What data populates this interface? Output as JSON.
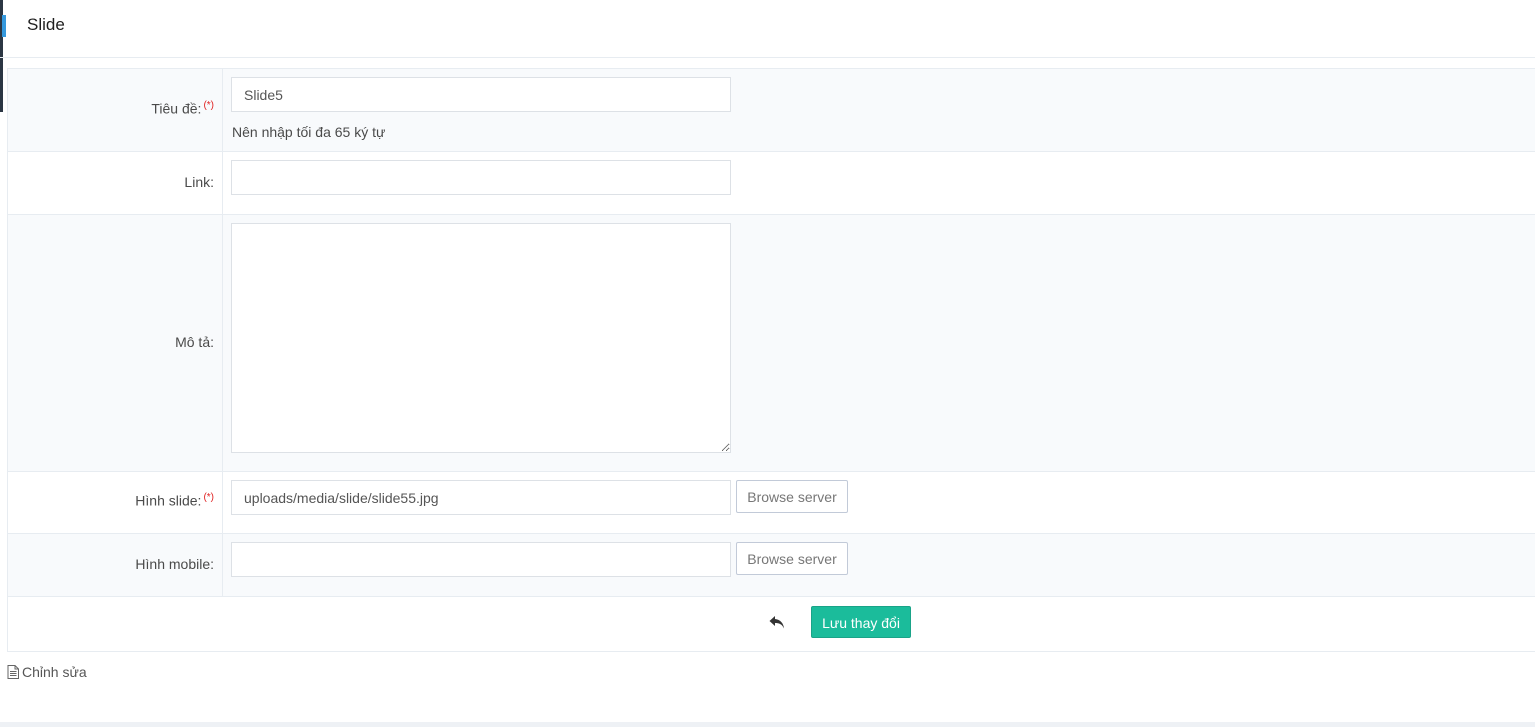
{
  "panel": {
    "title": "Slide"
  },
  "form": {
    "title": {
      "label": "Tiêu đề:",
      "required_mark": "(*)",
      "value": "Slide5",
      "help": "Nên nhập tối đa 65 ký tự"
    },
    "link": {
      "label": "Link:",
      "value": ""
    },
    "description": {
      "label": "Mô tả:",
      "value": ""
    },
    "slide_image": {
      "label": "Hình slide:",
      "required_mark": "(*)",
      "value": "uploads/media/slide/slide55.jpg",
      "browse_label": "Browse server"
    },
    "mobile_image": {
      "label": "Hình mobile:",
      "value": "",
      "browse_label": "Browse server"
    }
  },
  "actions": {
    "back_icon": "reply-arrow-icon",
    "save_label": "Lưu thay đổi",
    "save_color": "#1bbc9b"
  },
  "footer": {
    "icon": "document-icon",
    "label": "Chỉnh sửa"
  },
  "colors": {
    "accent": "#3598dc",
    "required": "#e02222"
  }
}
